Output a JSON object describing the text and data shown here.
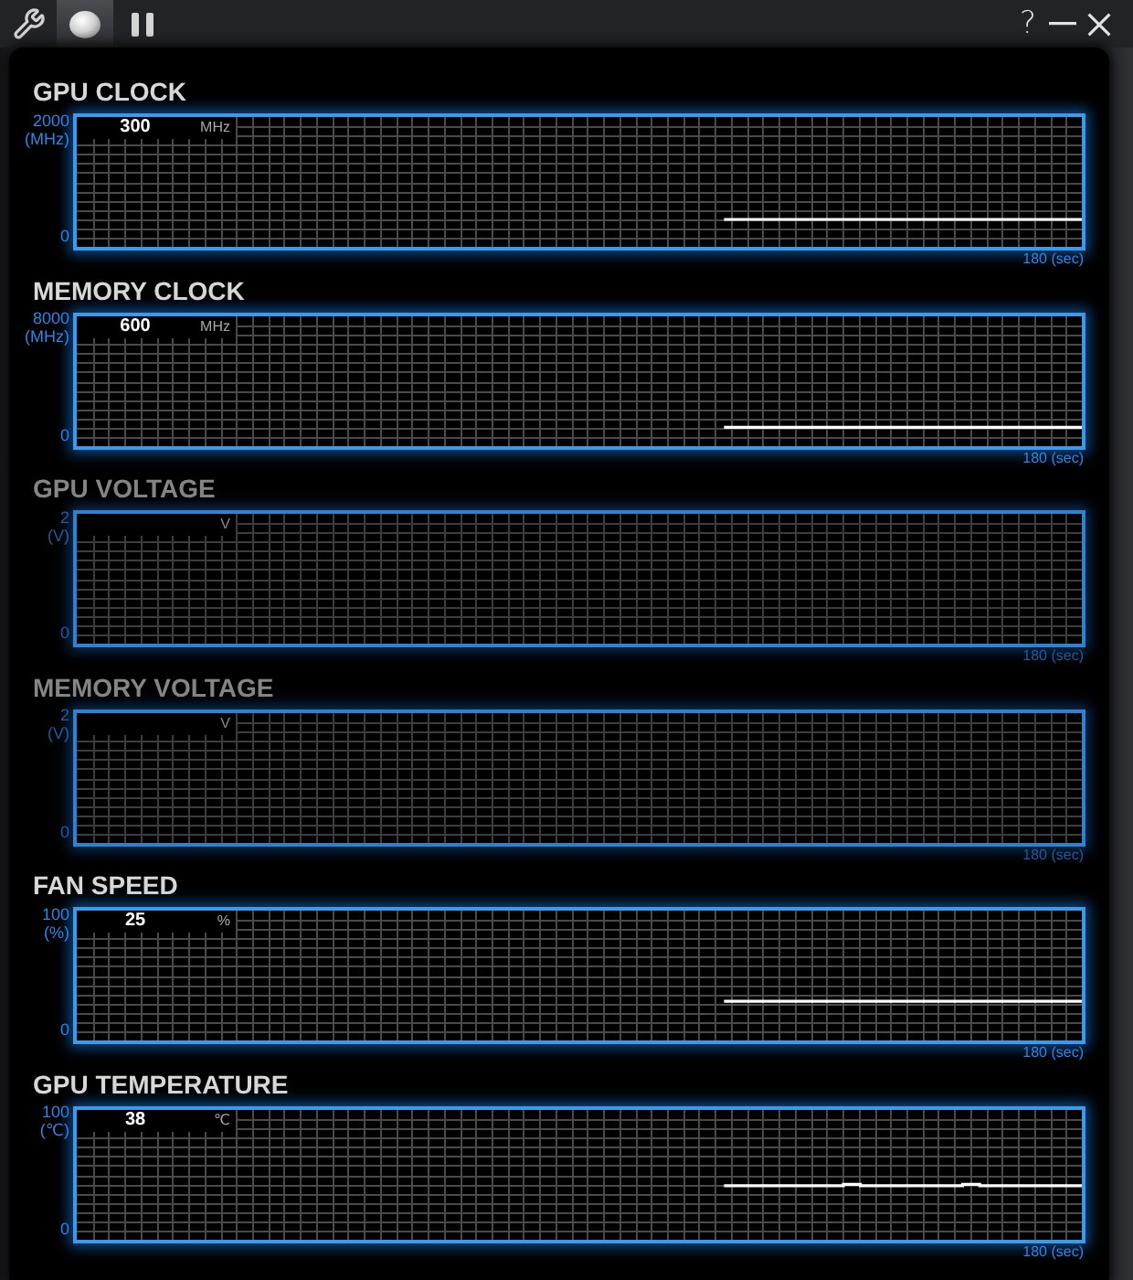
{
  "title_bar": {
    "tabs": [
      {
        "selected": false
      },
      {
        "selected": true
      },
      {
        "selected": false
      }
    ],
    "help": "?"
  },
  "panels": [
    {
      "disabled": false,
      "value": "300",
      "unit": "MHz",
      "chart_data": {
        "type": "line",
        "title": "GPU CLOCK",
        "ylabel": "(MHz)",
        "xlabel": "180 (sec)",
        "grid": true,
        "ylim": [
          0,
          2000
        ],
        "yticks": [
          {
            "value": 2000,
            "label": "2000"
          },
          {
            "value": 0,
            "label": "0"
          }
        ],
        "categories": [
          null,
          null,
          null,
          null,
          null,
          null,
          null,
          null,
          null,
          null,
          null,
          null,
          null,
          null,
          null,
          null,
          null,
          null,
          null,
          null,
          null,
          null,
          null,
          null,
          null,
          null,
          null,
          null,
          null,
          null,
          null,
          null,
          null,
          null,
          null,
          null,
          null,
          null,
          null,
          null,
          null,
          null,
          null,
          null,
          null,
          null,
          null,
          null,
          null,
          null,
          null,
          null,
          null,
          null,
          null,
          null,
          null,
          null,
          null,
          null
        ],
        "series": [
          {
            "color": "#ffffff",
            "values": [
              null,
              null,
              null,
              null,
              null,
              null,
              null,
              null,
              null,
              null,
              null,
              null,
              null,
              null,
              null,
              null,
              null,
              null,
              null,
              null,
              null,
              null,
              null,
              null,
              null,
              null,
              null,
              null,
              null,
              null,
              null,
              null,
              null,
              null,
              null,
              null,
              null,
              null,
              300,
              300,
              300,
              300,
              300,
              300,
              300,
              300,
              300,
              300,
              300,
              300,
              300,
              300,
              300,
              300,
              300,
              300,
              300,
              300,
              300,
              300
            ]
          }
        ]
      }
    },
    {
      "disabled": false,
      "value": "600",
      "unit": "MHz",
      "chart_data": {
        "type": "line",
        "title": "MEMORY CLOCK",
        "ylabel": "(MHz)",
        "xlabel": "180 (sec)",
        "grid": true,
        "ylim": [
          0,
          8000
        ],
        "yticks": [
          {
            "value": 8000,
            "label": "8000"
          },
          {
            "value": 0,
            "label": "0"
          }
        ],
        "categories": [
          null,
          null,
          null,
          null,
          null,
          null,
          null,
          null,
          null,
          null,
          null,
          null,
          null,
          null,
          null,
          null,
          null,
          null,
          null,
          null,
          null,
          null,
          null,
          null,
          null,
          null,
          null,
          null,
          null,
          null,
          null,
          null,
          null,
          null,
          null,
          null,
          null,
          null,
          null,
          null,
          null,
          null,
          null,
          null,
          null,
          null,
          null,
          null,
          null,
          null,
          null,
          null,
          null,
          null,
          null,
          null,
          null,
          null,
          null,
          null
        ],
        "series": [
          {
            "color": "#ffffff",
            "values": [
              null,
              null,
              null,
              null,
              null,
              null,
              null,
              null,
              null,
              null,
              null,
              null,
              null,
              null,
              null,
              null,
              null,
              null,
              null,
              null,
              null,
              null,
              null,
              null,
              null,
              null,
              null,
              null,
              null,
              null,
              null,
              null,
              null,
              null,
              null,
              null,
              null,
              null,
              600,
              600,
              600,
              600,
              600,
              600,
              600,
              600,
              600,
              600,
              600,
              600,
              600,
              600,
              600,
              600,
              600,
              600,
              600,
              600,
              600,
              600
            ]
          }
        ]
      }
    },
    {
      "disabled": true,
      "unit": "V",
      "chart_data": {
        "type": "line",
        "title": "GPU VOLTAGE",
        "ylabel": "(V)",
        "xlabel": "180 (sec)",
        "grid": true,
        "ylim": [
          0,
          2
        ],
        "yticks": [
          {
            "value": 2,
            "label": "2"
          },
          {
            "value": 0,
            "label": "0"
          }
        ],
        "categories": [
          null,
          null,
          null,
          null,
          null,
          null,
          null,
          null,
          null,
          null,
          null,
          null,
          null,
          null,
          null,
          null,
          null,
          null,
          null,
          null,
          null,
          null,
          null,
          null,
          null,
          null,
          null,
          null,
          null,
          null,
          null,
          null,
          null,
          null,
          null,
          null,
          null,
          null,
          null,
          null,
          null,
          null,
          null,
          null,
          null,
          null,
          null,
          null,
          null,
          null,
          null,
          null,
          null,
          null,
          null,
          null,
          null,
          null,
          null,
          null
        ]
      }
    },
    {
      "disabled": true,
      "unit": "V",
      "chart_data": {
        "type": "line",
        "title": "MEMORY VOLTAGE",
        "ylabel": "(V)",
        "xlabel": "180 (sec)",
        "grid": true,
        "ylim": [
          0,
          2
        ],
        "yticks": [
          {
            "value": 2,
            "label": "2"
          },
          {
            "value": 0,
            "label": "0"
          }
        ],
        "categories": [
          null,
          null,
          null,
          null,
          null,
          null,
          null,
          null,
          null,
          null,
          null,
          null,
          null,
          null,
          null,
          null,
          null,
          null,
          null,
          null,
          null,
          null,
          null,
          null,
          null,
          null,
          null,
          null,
          null,
          null,
          null,
          null,
          null,
          null,
          null,
          null,
          null,
          null,
          null,
          null,
          null,
          null,
          null,
          null,
          null,
          null,
          null,
          null,
          null,
          null,
          null,
          null,
          null,
          null,
          null,
          null,
          null,
          null,
          null,
          null
        ]
      }
    },
    {
      "disabled": false,
      "value": "25",
      "unit": "%",
      "chart_data": {
        "type": "line",
        "title": "FAN SPEED",
        "ylabel": "(%)",
        "xlabel": "180 (sec)",
        "grid": true,
        "ylim": [
          0,
          100
        ],
        "yticks": [
          {
            "value": 100,
            "label": "100"
          },
          {
            "value": 0,
            "label": "0"
          }
        ],
        "categories": [
          null,
          null,
          null,
          null,
          null,
          null,
          null,
          null,
          null,
          null,
          null,
          null,
          null,
          null,
          null,
          null,
          null,
          null,
          null,
          null,
          null,
          null,
          null,
          null,
          null,
          null,
          null,
          null,
          null,
          null,
          null,
          null,
          null,
          null,
          null,
          null,
          null,
          null,
          null,
          null,
          null,
          null,
          null,
          null,
          null,
          null,
          null,
          null,
          null,
          null,
          null,
          null,
          null,
          null,
          null,
          null,
          null,
          null,
          null,
          null
        ],
        "series": [
          {
            "color": "#ffffff",
            "values": [
              null,
              null,
              null,
              null,
              null,
              null,
              null,
              null,
              null,
              null,
              null,
              null,
              null,
              null,
              null,
              null,
              null,
              null,
              null,
              null,
              null,
              null,
              null,
              null,
              null,
              null,
              null,
              null,
              null,
              null,
              null,
              null,
              null,
              null,
              null,
              null,
              null,
              null,
              25,
              25,
              25,
              25,
              25,
              25,
              25,
              25,
              25,
              25,
              25,
              25,
              25,
              25,
              25,
              25,
              25,
              25,
              25,
              25,
              25,
              25
            ]
          }
        ]
      }
    },
    {
      "disabled": false,
      "value": "38",
      "unit": "℃",
      "chart_data": {
        "type": "line",
        "title": "GPU TEMPERATURE",
        "ylabel": "(℃)",
        "xlabel": "180 (sec)",
        "grid": true,
        "ylim": [
          0,
          100
        ],
        "yticks": [
          {
            "value": 100,
            "label": "100"
          },
          {
            "value": 0,
            "label": "0"
          }
        ],
        "categories": [
          null,
          null,
          null,
          null,
          null,
          null,
          null,
          null,
          null,
          null,
          null,
          null,
          null,
          null,
          null,
          null,
          null,
          null,
          null,
          null,
          null,
          null,
          null,
          null,
          null,
          null,
          null,
          null,
          null,
          null,
          null,
          null,
          null,
          null,
          null,
          null,
          null,
          null,
          null,
          null,
          null,
          null,
          null,
          null,
          null,
          null,
          null,
          null,
          null,
          null,
          null,
          null,
          null,
          null,
          null,
          null,
          null,
          null,
          null,
          null
        ],
        "series": [
          {
            "color": "#ffffff",
            "values": [
              null,
              null,
              null,
              null,
              null,
              null,
              null,
              null,
              null,
              null,
              null,
              null,
              null,
              null,
              null,
              null,
              null,
              null,
              null,
              null,
              null,
              null,
              null,
              null,
              null,
              null,
              null,
              null,
              null,
              null,
              null,
              null,
              null,
              null,
              null,
              null,
              null,
              null,
              38,
              38,
              38,
              38,
              38,
              38,
              38,
              39,
              38,
              38,
              38,
              38,
              38,
              38,
              39,
              38,
              38,
              38,
              38,
              38,
              38,
              38
            ]
          }
        ]
      }
    }
  ]
}
